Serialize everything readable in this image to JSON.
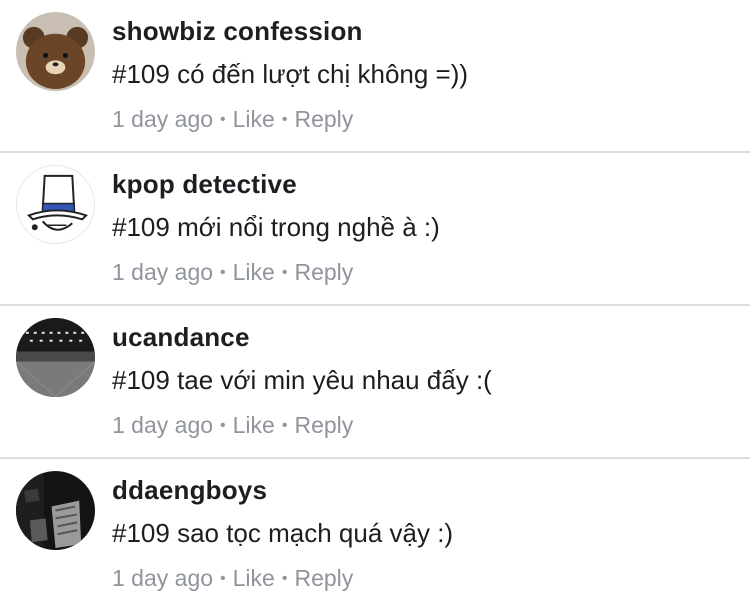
{
  "comments": [
    {
      "avatar_icon": "brown-bear-avatar-icon",
      "author": "showbiz confession",
      "text": "#109 có đến lượt chị không =))",
      "time": "1 day ago",
      "like_label": "Like",
      "reply_label": "Reply",
      "separator": "•"
    },
    {
      "avatar_icon": "kaito-kid-avatar-icon",
      "author": "kpop detective",
      "text": "#109 mới nổi trong nghề à :)",
      "time": "1 day ago",
      "like_label": "Like",
      "reply_label": "Reply",
      "separator": "•"
    },
    {
      "avatar_icon": "dark-hall-avatar-icon",
      "author": "ucandance",
      "text": "#109 tae với min yêu nhau đấy :(",
      "time": "1 day ago",
      "like_label": "Like",
      "reply_label": "Reply",
      "separator": "•"
    },
    {
      "avatar_icon": "dark-photo-avatar-icon",
      "author": "ddaengboys",
      "text": "#109 sao tọc mạch quá vậy :)",
      "time": "1 day ago",
      "like_label": "Like",
      "reply_label": "Reply",
      "separator": "•"
    }
  ],
  "colors": {
    "name_text": "#1c1e21",
    "meta_text": "#90949c",
    "divider": "#dadde1"
  }
}
